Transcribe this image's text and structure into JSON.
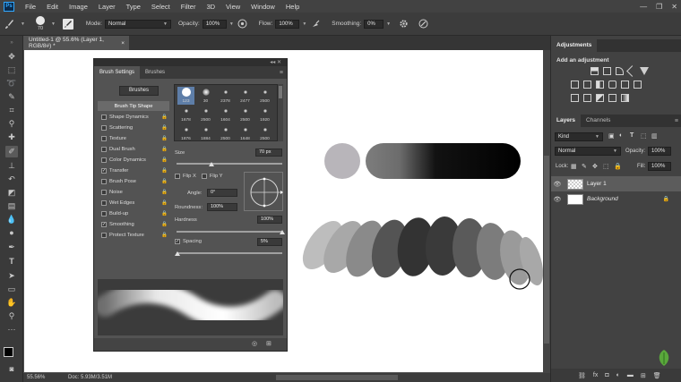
{
  "menubar": {
    "logo": "Ps",
    "items": [
      "File",
      "Edit",
      "Image",
      "Layer",
      "Type",
      "Select",
      "Filter",
      "3D",
      "View",
      "Window",
      "Help"
    ],
    "window_controls": [
      "—",
      "❐",
      "✕"
    ]
  },
  "options": {
    "brush_size": "70",
    "mode_label": "Mode:",
    "mode_value": "Normal",
    "opacity_label": "Opacity:",
    "opacity_value": "100%",
    "flow_label": "Flow:",
    "flow_value": "100%",
    "smoothing_label": "Smoothing:",
    "smoothing_value": "0%"
  },
  "document": {
    "tab_title": "Untitled-1 @ 55.6% (Layer 1, RGB/8#) *",
    "close": "×"
  },
  "status": {
    "zoom": "55.56%",
    "doc_info": "Doc: 5.93M/3.51M"
  },
  "adjustments": {
    "panel_title": "Adjustments",
    "subtitle": "Add an adjustment"
  },
  "layers_panel": {
    "tabs": [
      "Layers",
      "Channels"
    ],
    "kind_label": "Kind",
    "blend_mode": "Normal",
    "opacity_label": "Opacity:",
    "opacity_value": "100%",
    "lock_label": "Lock:",
    "fill_label": "Fill:",
    "fill_value": "100%",
    "layers": [
      {
        "name": "Layer 1",
        "selected": true
      },
      {
        "name": "Background",
        "selected": false
      }
    ]
  },
  "brush_panel": {
    "tabs": [
      "Brush Settings",
      "Brushes"
    ],
    "brushes_button": "Brushes",
    "settings": [
      {
        "label": "Brush Tip Shape",
        "checked": null,
        "selected": true
      },
      {
        "label": "Shape Dynamics",
        "checked": false
      },
      {
        "label": "Scattering",
        "checked": false
      },
      {
        "label": "Texture",
        "checked": false
      },
      {
        "label": "Dual Brush",
        "checked": false
      },
      {
        "label": "Color Dynamics",
        "checked": false
      },
      {
        "label": "Transfer",
        "checked": true
      },
      {
        "label": "Brush Pose",
        "checked": false
      },
      {
        "label": "Noise",
        "checked": false
      },
      {
        "label": "Wet Edges",
        "checked": false
      },
      {
        "label": "Build-up",
        "checked": false
      },
      {
        "label": "Smoothing",
        "checked": true
      },
      {
        "label": "Protect Texture",
        "checked": false
      }
    ],
    "tips": [
      "123",
      "30",
      "2378",
      "2477",
      "2500",
      "1678",
      "2500",
      "1604",
      "2500",
      "1920",
      "1876",
      "1884",
      "2500",
      "1648",
      "2500"
    ],
    "size_label": "Size",
    "size_value": "70 px",
    "flip_x": "Flip X",
    "flip_y": "Flip Y",
    "angle_label": "Angle:",
    "angle_value": "0°",
    "roundness_label": "Roundness:",
    "roundness_value": "100%",
    "hardness_label": "Hardness",
    "hardness_value": "100%",
    "spacing_label": "Spacing",
    "spacing_value": "5%",
    "spacing_checked": true
  }
}
